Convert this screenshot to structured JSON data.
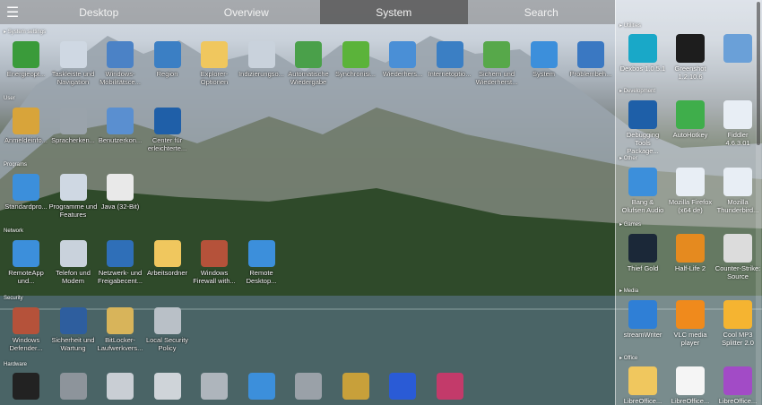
{
  "nav": {
    "menu_icon": "hamburger-icon",
    "tabs": [
      "Desktop",
      "Overview",
      "System",
      "Search"
    ],
    "active_tab": "System"
  },
  "main": {
    "sections": {
      "system_settings": "System settings",
      "user": "User",
      "programs": "Programs",
      "network": "Network",
      "security": "Security",
      "hardware": "Hardware"
    },
    "system_items": [
      {
        "label": "Energieopt...",
        "icon": "battery-plug-icon"
      },
      {
        "label": "Taskleiste und Navigation",
        "icon": "taskbar-icon"
      },
      {
        "label": "Windows-Mobilitätsce...",
        "icon": "mobility-icon"
      },
      {
        "label": "Region",
        "icon": "globe-clock-icon"
      },
      {
        "label": "Explorer-Optionen",
        "icon": "folder-options-icon"
      },
      {
        "label": "Indizierungso...",
        "icon": "index-search-icon"
      },
      {
        "label": "Automatische Wiedergabe",
        "icon": "autoplay-icon"
      },
      {
        "label": "Synchronisi...",
        "icon": "sync-icon"
      },
      {
        "label": "Wiederhers...",
        "icon": "recovery-icon"
      },
      {
        "label": "Internetoptio...",
        "icon": "internet-options-icon"
      },
      {
        "label": "Sichern und Wiederherst...",
        "icon": "backup-restore-icon"
      },
      {
        "label": "System",
        "icon": "system-monitor-icon"
      },
      {
        "label": "Problembeh...",
        "icon": "troubleshoot-icon"
      }
    ],
    "user_items": [
      {
        "label": "Anmeldeinfo...",
        "icon": "credential-vault-icon"
      },
      {
        "label": "Spracherken...",
        "icon": "microphone-icon"
      },
      {
        "label": "Benutzerkon...",
        "icon": "users-icon"
      },
      {
        "label": "Center für erleichterte...",
        "icon": "ease-of-access-icon"
      }
    ],
    "program_items": [
      {
        "label": "Standardpro...",
        "icon": "default-programs-icon"
      },
      {
        "label": "Programme und Features",
        "icon": "programs-features-icon"
      },
      {
        "label": "Java (32-Bit)",
        "icon": "java-icon"
      }
    ],
    "network_items": [
      {
        "label": "RemoteApp und...",
        "icon": "remoteapp-icon"
      },
      {
        "label": "Telefon und Modem",
        "icon": "phone-modem-icon"
      },
      {
        "label": "Netzwerk- und Freigabecent...",
        "icon": "network-center-icon"
      },
      {
        "label": "Arbeitsordner",
        "icon": "work-folders-icon"
      },
      {
        "label": "Windows Firewall with...",
        "icon": "firewall-icon"
      },
      {
        "label": "Remote Desktop...",
        "icon": "remote-desktop-icon"
      }
    ],
    "security_items": [
      {
        "label": "Windows Defender...",
        "icon": "defender-icon"
      },
      {
        "label": "Sicherheit und Wartung",
        "icon": "security-flag-icon"
      },
      {
        "label": "BitLocker-Laufwerkvers...",
        "icon": "bitlocker-icon"
      },
      {
        "label": "Local Security Policy",
        "icon": "security-policy-icon"
      }
    ],
    "hardware_items": [
      {
        "label": "",
        "icon": "bo-logo-icon"
      },
      {
        "label": "",
        "icon": "mouse-icon"
      },
      {
        "label": "",
        "icon": "keyboard-icon"
      },
      {
        "label": "",
        "icon": "devices-printers-icon"
      },
      {
        "label": "",
        "icon": "scanner-camera-icon"
      },
      {
        "label": "",
        "icon": "display-icon"
      },
      {
        "label": "",
        "icon": "speaker-icon"
      },
      {
        "label": "",
        "icon": "pen-tablet-icon"
      },
      {
        "label": "",
        "icon": "x-badge-icon"
      },
      {
        "label": "",
        "icon": "color-management-icon"
      }
    ]
  },
  "panel": {
    "sections": {
      "utilities": "Utilities",
      "development": "Development",
      "other": "Other",
      "games": "Games",
      "media": "Media",
      "office": "Office"
    },
    "utilities": [
      {
        "label": "Dexbos 1.0.5.1",
        "icon": "dexbos-icon"
      },
      {
        "label": "Greenshot 1.2.10.6",
        "icon": "greenshot-icon"
      },
      {
        "label": "",
        "icon": "blurred-app-icon"
      }
    ],
    "development": [
      {
        "label": "Debugging Tools Package...",
        "icon": "powershell-icon"
      },
      {
        "label": "AutoHotkey",
        "icon": "autohotkey-icon"
      },
      {
        "label": "Fiddler 4.6.3.01",
        "icon": "app-window-icon"
      }
    ],
    "other": [
      {
        "label": "Bang & Olufsen Audio",
        "icon": "audio-monitor-icon"
      },
      {
        "label": "Mozilla Firefox (x64 de)",
        "icon": "app-window-icon"
      },
      {
        "label": "Mozilla Thunderbird...",
        "icon": "app-window-icon"
      }
    ],
    "games": [
      {
        "label": "Thief Gold",
        "icon": "steam-icon"
      },
      {
        "label": "Half-Life 2",
        "icon": "half-life-icon"
      },
      {
        "label": "Counter-Strike: Source",
        "icon": "counter-strike-icon"
      }
    ],
    "media": [
      {
        "label": "streamWriter",
        "icon": "music-note-icon"
      },
      {
        "label": "VLC media player",
        "icon": "vlc-cone-icon"
      },
      {
        "label": "Cool MP3 Splitter 2.0",
        "icon": "smiley-icon"
      }
    ],
    "office": [
      {
        "label": "LibreOffice...",
        "icon": "folder-icon"
      },
      {
        "label": "LibreOffice...",
        "icon": "document-icon"
      },
      {
        "label": "LibreOffice...",
        "icon": "libreoffice-math-icon"
      }
    ]
  }
}
